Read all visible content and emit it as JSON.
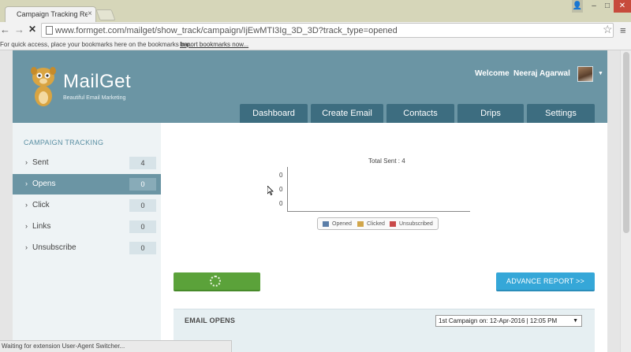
{
  "browser": {
    "tab_title": "Campaign Tracking Repo",
    "tab_close": "×",
    "url": "www.formget.com/mailget/show_track/campaign/IjEwMTI3Ig_3D_3D?track_type=opened",
    "bookmarks_hint": "For quick access, place your bookmarks here on the bookmarks bar.",
    "import_link": "Import bookmarks now...",
    "status": "Waiting for extension User-Agent Switcher..."
  },
  "header": {
    "brand": "MailGet",
    "tagline": "Beautiful Email Marketing",
    "welcome": "Welcome",
    "user_name": "Neeraj Agarwal",
    "color": "#6b95a4"
  },
  "nav": {
    "tabs": [
      {
        "label": "Dashboard"
      },
      {
        "label": "Create Email"
      },
      {
        "label": "Contacts"
      },
      {
        "label": "Drips"
      },
      {
        "label": "Settings"
      }
    ]
  },
  "sidebar": {
    "title": "CAMPAIGN TRACKING",
    "items": [
      {
        "label": "Sent",
        "count": "4"
      },
      {
        "label": "Opens",
        "count": "0",
        "active": true
      },
      {
        "label": "Click",
        "count": "0"
      },
      {
        "label": "Links",
        "count": "0"
      },
      {
        "label": "Unsubscribe",
        "count": "0"
      }
    ]
  },
  "chart": {
    "total_sent": "Total Sent : 4",
    "y_ticks": [
      "0",
      "0",
      "0"
    ],
    "legend": [
      {
        "label": "Opened",
        "color": "#5b7ea8"
      },
      {
        "label": "Clicked",
        "color": "#d1a64b"
      },
      {
        "label": "Unsubscribed",
        "color": "#c94a4a"
      }
    ]
  },
  "actions": {
    "advance_report": "ADVANCE REPORT >>"
  },
  "opens": {
    "title": "EMAIL OPENS",
    "campaign_select": "1st Campaign on: 12-Apr-2016 | 12:05 PM"
  }
}
